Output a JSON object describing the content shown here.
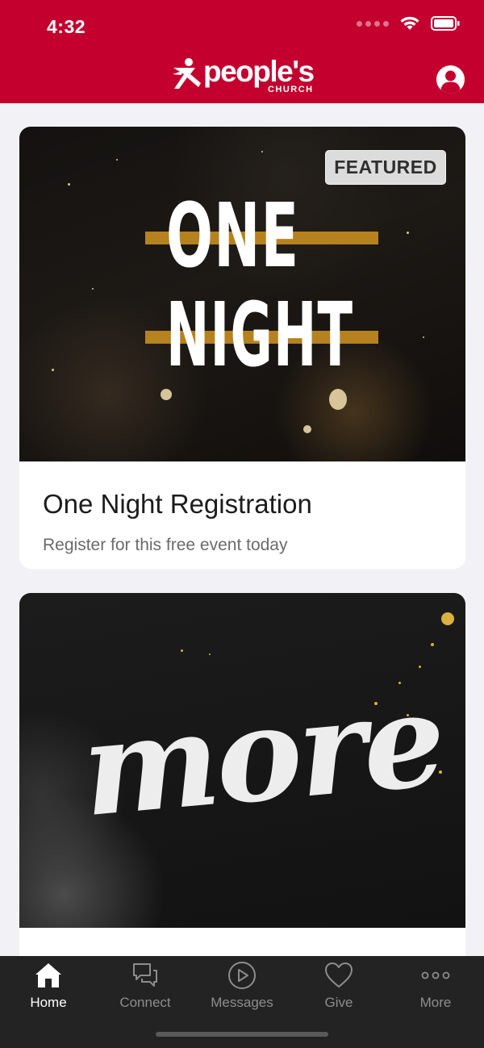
{
  "status_bar": {
    "time": "4:32"
  },
  "header": {
    "logo_word": "people's",
    "logo_sub": "CHURCH",
    "brand_color": "#c4002f",
    "profile_icon": "person-icon"
  },
  "feed": [
    {
      "badge": "FEATURED",
      "image_title_line1": "ONE",
      "image_title_line2": "NIGHT",
      "title": "One Night Registration",
      "subtitle": "Register for this free event today"
    },
    {
      "image_title": "more"
    }
  ],
  "tabs": [
    {
      "label": "Home",
      "icon": "home-icon",
      "active": true
    },
    {
      "label": "Connect",
      "icon": "chat-icon",
      "active": false
    },
    {
      "label": "Messages",
      "icon": "play-icon",
      "active": false
    },
    {
      "label": "Give",
      "icon": "heart-icon",
      "active": false
    },
    {
      "label": "More",
      "icon": "ellipsis-icon",
      "active": false
    }
  ]
}
